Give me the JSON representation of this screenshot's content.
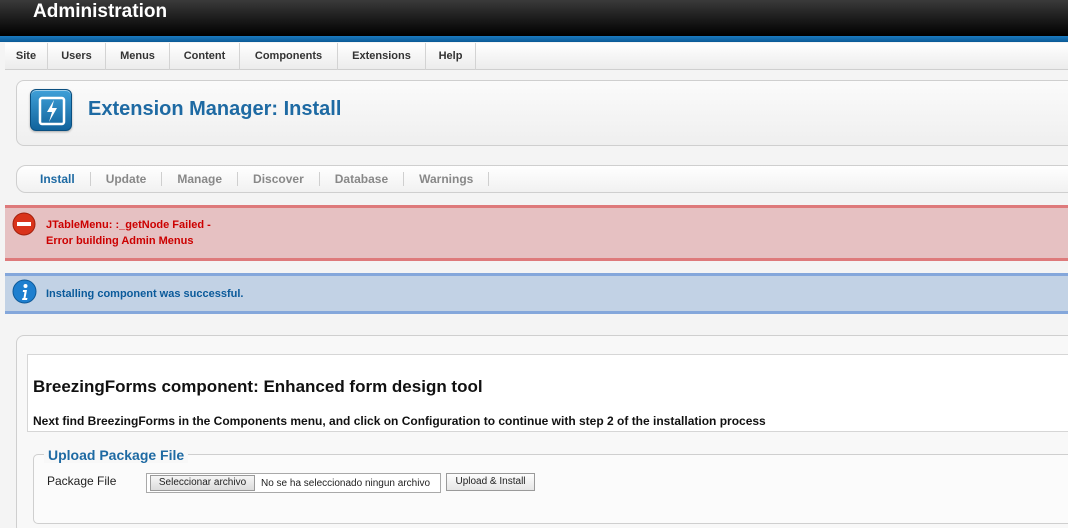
{
  "header": {
    "title": "Administration"
  },
  "menu": {
    "items": [
      {
        "label": "Site"
      },
      {
        "label": "Users"
      },
      {
        "label": "Menus"
      },
      {
        "label": "Content"
      },
      {
        "label": "Components"
      },
      {
        "label": "Extensions"
      },
      {
        "label": "Help"
      }
    ]
  },
  "toolbar": {
    "title": "Extension Manager: Install",
    "icon": "extension-manager-icon"
  },
  "subnav": {
    "tabs": [
      {
        "label": "Install",
        "active": true
      },
      {
        "label": "Update"
      },
      {
        "label": "Manage"
      },
      {
        "label": "Discover"
      },
      {
        "label": "Database"
      },
      {
        "label": "Warnings"
      }
    ]
  },
  "error": {
    "line1": "JTableMenu: :_getNode Failed -",
    "line2": "Error building Admin Menus",
    "icon": "error-icon",
    "color": "#cc0000"
  },
  "message": {
    "text": "Installing component was successful.",
    "icon": "info-icon"
  },
  "component": {
    "title": "BreezingForms component: Enhanced form design tool",
    "description": "Next find BreezingForms in the Components menu, and click on Configuration to continue with step 2 of the installation process"
  },
  "upload": {
    "legend": "Upload Package File",
    "package_label": "Package File",
    "file_button": "Seleccionar archivo",
    "file_status": "No se ha seleccionado ningun archivo",
    "submit_button": "Upload & Install"
  },
  "colors": {
    "brand_blue": "#1e6aa3",
    "error_red": "#cc0000",
    "info_blue": "#0a5a9a"
  }
}
